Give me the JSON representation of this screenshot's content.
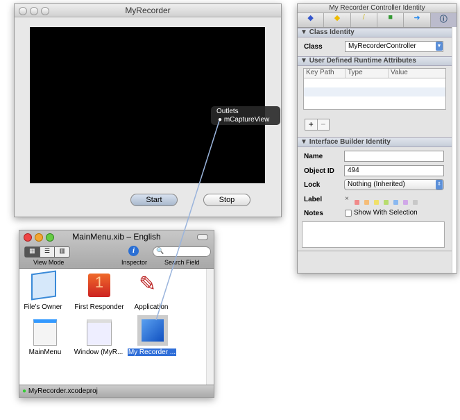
{
  "recorder": {
    "title": "MyRecorder",
    "start": "Start",
    "stop": "Stop"
  },
  "outlets": {
    "title": "Outlets",
    "item": "mCaptureView"
  },
  "inspector": {
    "title": "My Recorder Controller Identity",
    "tabs": [
      "bindings-icon",
      "effects-icon",
      "size-icon",
      "connections-icon",
      "arrow-icon",
      "info-icon"
    ],
    "class_identity": "Class Identity",
    "class_label": "Class",
    "class_value": "MyRecorderController",
    "udra": "User Defined Runtime Attributes",
    "columns": [
      "Key Path",
      "Type",
      "Value"
    ],
    "add": "+",
    "remove": "−",
    "ib_identity": "Interface Builder Identity",
    "name_label": "Name",
    "name_value": "",
    "objid_label": "Object ID",
    "objid_value": "494",
    "lock_label": "Lock",
    "lock_value": "Nothing (Inherited)",
    "label_label": "Label",
    "label_none": "×",
    "label_colors": [
      "#f08a8a",
      "#f5bd78",
      "#f0e06a",
      "#b8dc6e",
      "#8ab8f0",
      "#d0a8e8",
      "#c8c8c8"
    ],
    "notes_label": "Notes",
    "show_with_selection": "Show With Selection"
  },
  "mainmenu": {
    "title": "MainMenu.xib – English",
    "view_mode": "View Mode",
    "inspector": "Inspector",
    "search": "Search Field",
    "items": [
      "File's Owner",
      "First Responder",
      "Application",
      "MainMenu",
      "Window (MyR...",
      "My Recorder ..."
    ],
    "status": "MyRecorder.xcodeproj"
  }
}
